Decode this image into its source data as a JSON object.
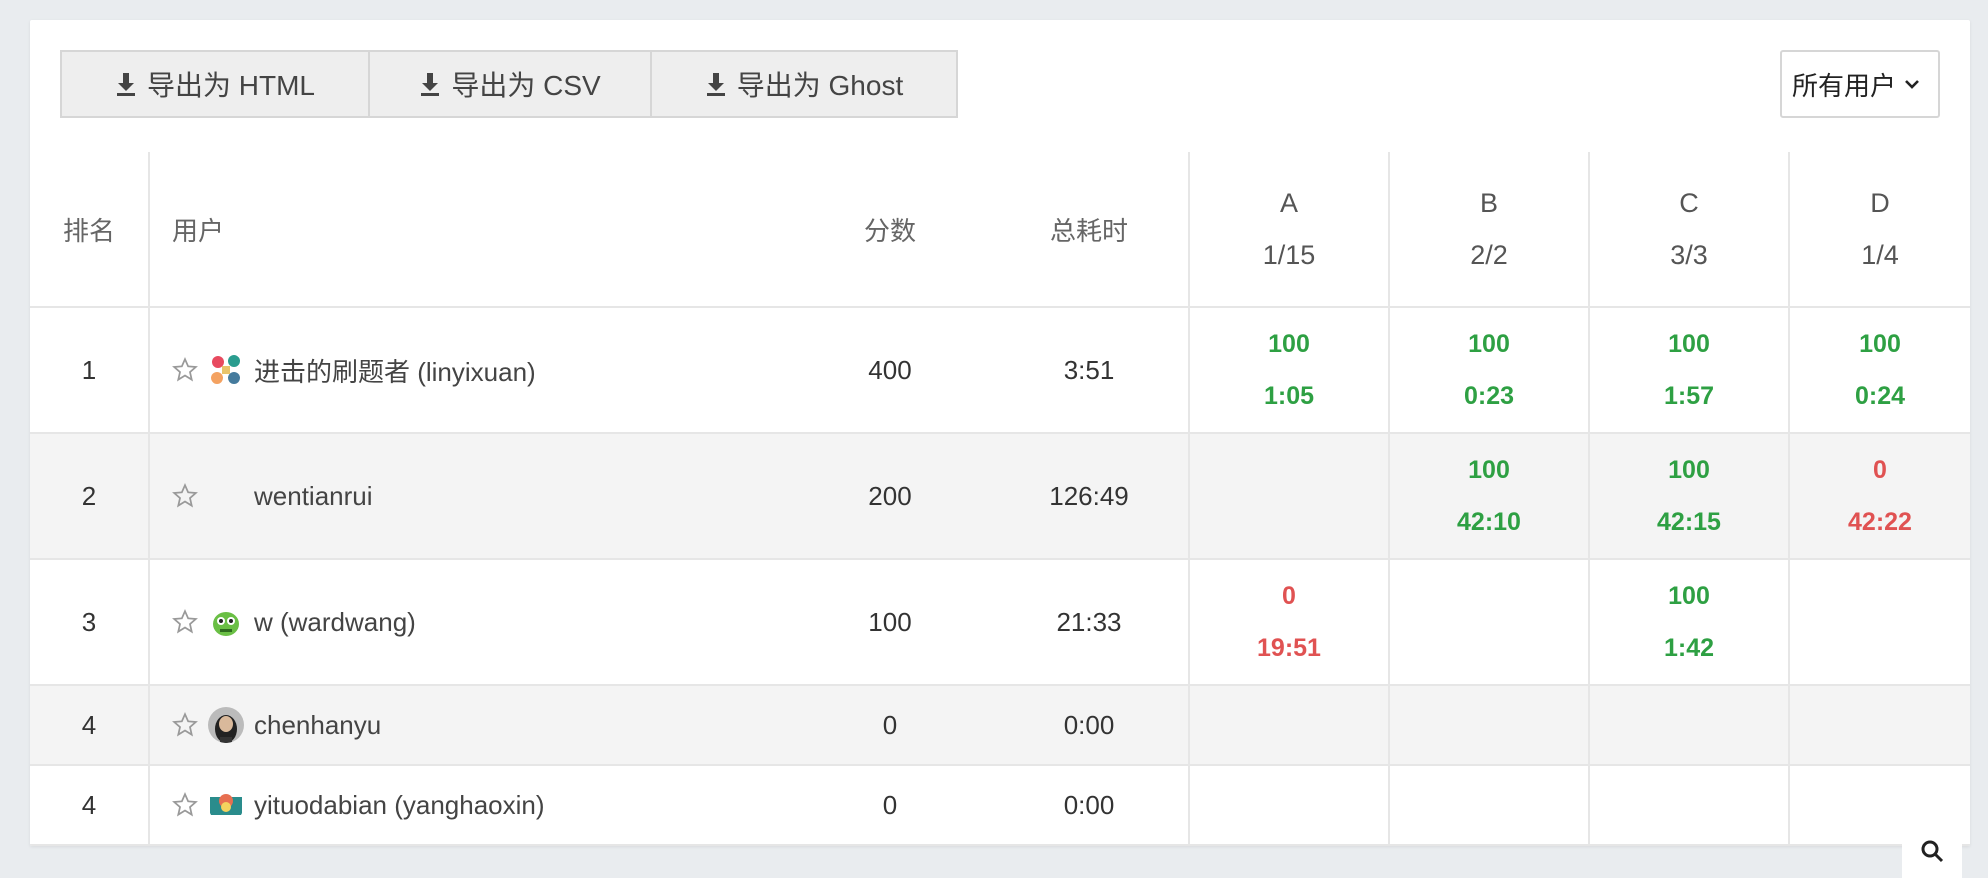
{
  "toolbar": {
    "export_html": "导出为 HTML",
    "export_csv": "导出为 CSV",
    "export_ghost": "导出为 Ghost"
  },
  "filter": {
    "selected": "所有用户"
  },
  "headers": {
    "rank": "排名",
    "user": "用户",
    "score": "分数",
    "total_time": "总耗时",
    "problems": [
      {
        "letter": "A",
        "stat": "1/15"
      },
      {
        "letter": "B",
        "stat": "2/2"
      },
      {
        "letter": "C",
        "stat": "3/3"
      },
      {
        "letter": "D",
        "stat": "1/4"
      }
    ]
  },
  "rows": [
    {
      "rank": "1",
      "name": "进击的刷题者 (linyixuan)",
      "score": "400",
      "time": "3:51",
      "results": [
        {
          "score": "100",
          "time": "1:05",
          "status": "ok"
        },
        {
          "score": "100",
          "time": "0:23",
          "status": "ok"
        },
        {
          "score": "100",
          "time": "1:57",
          "status": "ok"
        },
        {
          "score": "100",
          "time": "0:24",
          "status": "ok"
        }
      ]
    },
    {
      "rank": "2",
      "name": "wentianrui",
      "score": "200",
      "time": "126:49",
      "results": [
        {
          "score": "",
          "time": "",
          "status": "none"
        },
        {
          "score": "100",
          "time": "42:10",
          "status": "ok"
        },
        {
          "score": "100",
          "time": "42:15",
          "status": "ok"
        },
        {
          "score": "0",
          "time": "42:22",
          "status": "bad"
        }
      ]
    },
    {
      "rank": "3",
      "name": "w (wardwang)",
      "score": "100",
      "time": "21:33",
      "results": [
        {
          "score": "0",
          "time": "19:51",
          "status": "bad"
        },
        {
          "score": "",
          "time": "",
          "status": "none"
        },
        {
          "score": "100",
          "time": "1:42",
          "status": "ok"
        },
        {
          "score": "",
          "time": "",
          "status": "none"
        }
      ]
    },
    {
      "rank": "4",
      "name": "chenhanyu",
      "score": "0",
      "time": "0:00",
      "results": []
    },
    {
      "rank": "4",
      "name": "yituodabian (yanghaoxin)",
      "score": "0",
      "time": "0:00",
      "results": []
    }
  ],
  "colors": {
    "ok": "#2ea043",
    "bad": "#e05252"
  }
}
